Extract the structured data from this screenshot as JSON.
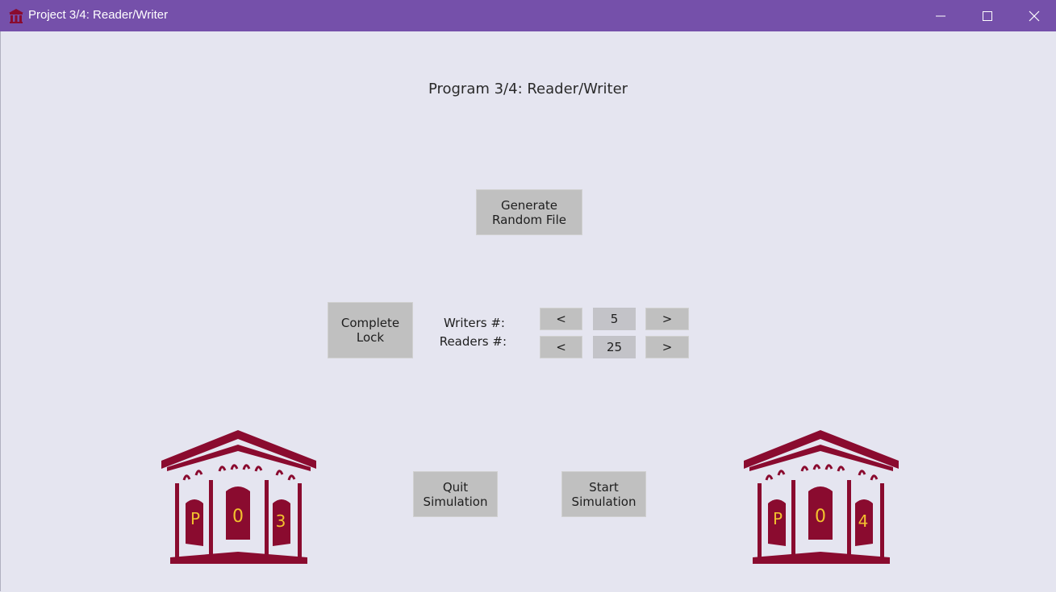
{
  "window": {
    "title": "Project 3/4: Reader/Writer",
    "icon": "building-icon",
    "titlebar_color": "#7550aa",
    "controls": [
      "minimize-icon",
      "maximize-icon",
      "close-icon"
    ]
  },
  "main": {
    "heading": "Program 3/4: Reader/Writer",
    "generate_button": "Generate\nRandom File",
    "lock_button": "Complete\nLock",
    "writers": {
      "label": "Writers #:",
      "decrement": "<",
      "value": "5",
      "increment": ">"
    },
    "readers": {
      "label": "Readers #:",
      "decrement": "<",
      "value": "25",
      "increment": ">"
    },
    "quit_button": "Quit\nSimulation",
    "start_button": "Start\nSimulation"
  },
  "logos": {
    "brand_color": "#8a0b2f",
    "letter_color": "#f2c12e",
    "left": {
      "letters": [
        "P",
        "0",
        "3"
      ]
    },
    "right": {
      "letters": [
        "P",
        "0",
        "4"
      ]
    }
  }
}
